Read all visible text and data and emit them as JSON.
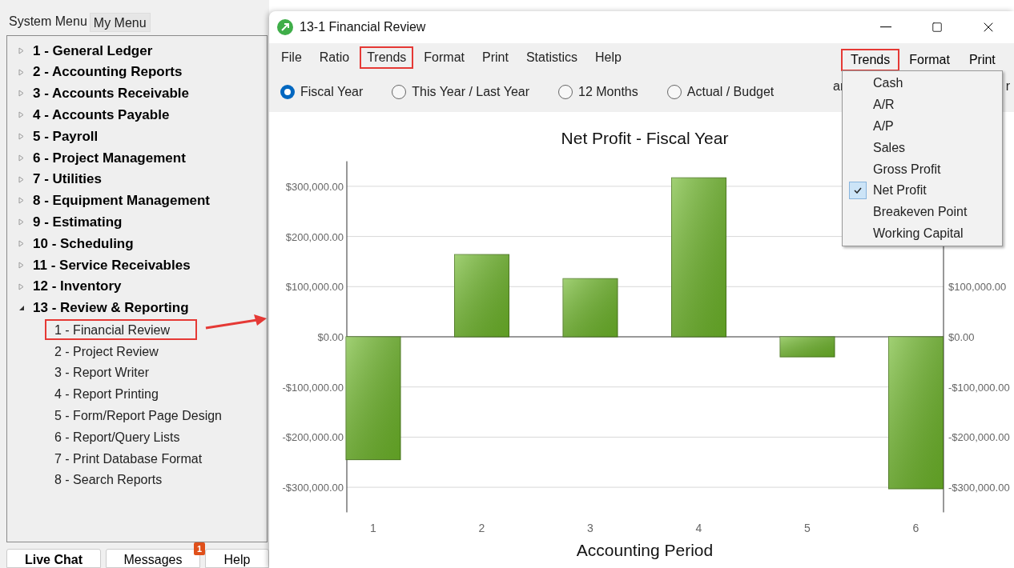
{
  "sidebar": {
    "tabs": [
      {
        "label": "System Menu",
        "selected": true
      },
      {
        "label": "My Menu",
        "selected": false
      }
    ],
    "tree": [
      {
        "label": "1 - General Ledger",
        "expanded": false
      },
      {
        "label": "2 - Accounting Reports",
        "expanded": false
      },
      {
        "label": "3 - Accounts Receivable",
        "expanded": false
      },
      {
        "label": "4 - Accounts Payable",
        "expanded": false
      },
      {
        "label": "5 - Payroll",
        "expanded": false
      },
      {
        "label": "6 - Project Management",
        "expanded": false
      },
      {
        "label": "7 - Utilities",
        "expanded": false
      },
      {
        "label": "8 - Equipment Management",
        "expanded": false
      },
      {
        "label": "9 - Estimating",
        "expanded": false
      },
      {
        "label": "10 - Scheduling",
        "expanded": false
      },
      {
        "label": "11 - Service Receivables",
        "expanded": false
      },
      {
        "label": "12 - Inventory",
        "expanded": false
      },
      {
        "label": "13 - Review & Reporting",
        "expanded": true,
        "children": [
          {
            "label": "1 - Financial Review",
            "highlighted": true
          },
          {
            "label": "2 - Project Review",
            "highlighted": false
          },
          {
            "label": "3 - Report Writer",
            "highlighted": false
          },
          {
            "label": "4 - Report Printing",
            "highlighted": false
          },
          {
            "label": "5 - Form/Report Page Design",
            "highlighted": false
          },
          {
            "label": "6 - Report/Query Lists",
            "highlighted": false
          },
          {
            "label": "7 - Print Database Format",
            "highlighted": false
          },
          {
            "label": "8 - Search Reports",
            "highlighted": false
          }
        ]
      }
    ],
    "bottom_tabs": [
      {
        "label": "Live Chat",
        "selected": true
      },
      {
        "label": "Messages",
        "selected": false,
        "badge": "1"
      },
      {
        "label": "Help",
        "selected": false
      }
    ]
  },
  "window": {
    "title": "13-1 Financial Review",
    "menu": [
      {
        "label": "File",
        "highlighted": false
      },
      {
        "label": "Ratio",
        "highlighted": false
      },
      {
        "label": "Trends",
        "highlighted": true
      },
      {
        "label": "Format",
        "highlighted": false
      },
      {
        "label": "Print",
        "highlighted": false
      },
      {
        "label": "Statistics",
        "highlighted": false
      },
      {
        "label": "Help",
        "highlighted": false
      }
    ],
    "radios": [
      {
        "label": "Fiscal Year",
        "selected": true
      },
      {
        "label": "This Year / Last Year",
        "selected": false
      },
      {
        "label": "12 Months",
        "selected": false
      },
      {
        "label": "Actual / Budget",
        "selected": false
      }
    ],
    "chart_data": {
      "type": "bar",
      "title": "Net Profit - Fiscal Year",
      "xlabel": "Accounting Period",
      "categories": [
        "1",
        "2",
        "3",
        "4",
        "5",
        "6"
      ],
      "grid": true,
      "series": [
        {
          "color": "#6fb82a",
          "values": [
            -245000,
            164000,
            116000,
            317000,
            -40000,
            -303000
          ]
        }
      ],
      "ylim": [
        -350000,
        350000
      ],
      "yticks": [
        {
          "value": 300000,
          "label": "$300,000.00"
        },
        {
          "value": 200000,
          "label": "$200,000.00"
        },
        {
          "value": 100000,
          "label": "$100,000.00"
        },
        {
          "value": 0,
          "label": "$0.00"
        },
        {
          "value": -100000,
          "label": "-$100,000.00"
        },
        {
          "value": -200000,
          "label": "-$200,000.00"
        },
        {
          "value": -300000,
          "label": "-$300,000.00"
        }
      ]
    },
    "right_axis_labels": [
      "$100,000.00",
      "$0.00",
      "-$100,000.00",
      "-$200,000.00",
      "-$300,000.00"
    ],
    "inset": {
      "menu": [
        {
          "label": "Trends",
          "highlighted": true
        },
        {
          "label": "Format",
          "highlighted": false
        },
        {
          "label": "Print",
          "highlighted": false
        }
      ],
      "fragments": [
        "ar",
        "r"
      ],
      "items": [
        {
          "label": "Cash",
          "checked": false
        },
        {
          "label": "A/R",
          "checked": false
        },
        {
          "label": "A/P",
          "checked": false
        },
        {
          "label": "Sales",
          "checked": false
        },
        {
          "label": "Gross Profit",
          "checked": false
        },
        {
          "label": "Net Profit",
          "checked": true
        },
        {
          "label": "Breakeven Point",
          "checked": false
        },
        {
          "label": "Working Capital",
          "checked": false
        }
      ]
    }
  }
}
